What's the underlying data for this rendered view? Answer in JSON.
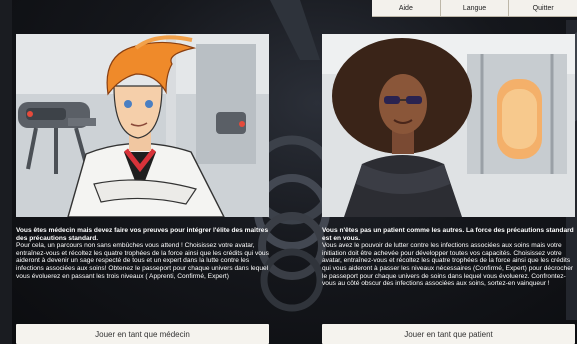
{
  "nav": {
    "items": [
      "Aide",
      "Langue",
      "Quitter"
    ]
  },
  "doctor": {
    "lead": "Vous êtes médecin mais devez faire vos preuves pour intégrer l'élite des maîtres des précautions standard.",
    "body": "Pour cela, un parcours non sans embûches vous attend ! Choisissez votre avatar, entraînez-vous et récoltez les quatre trophées de la force ainsi que les crédits qui vous aideront à devenir un sage respecté de tous et un expert dans la lutte contre les infections associées aux soins! Obtenez le passeport pour chaque univers dans lequel vous évoluerez en passant les trois niveaux ( Apprenti, Confirmé, Expert)",
    "button": "Jouer en tant que médecin"
  },
  "patient": {
    "lead": "Vous n'êtes pas un patient comme les autres. La force des précautions standard est en vous.",
    "body": "Vous avez le pouvoir de lutter contre les infections associées aux soins mais votre initiation doit être achevée pour développer toutes vos capacités. Choisissez votre avatar, entraînez-vous et récoltez les quatre trophées de la force ainsi que les crédits qui vous aideront à passer les niveaux nécessaires (Confirmé, Expert) pour décrocher le passeport pour chaque univers de soins dans lequel vous évoluerez. Confrontez-vous au côté obscur des infections associées aux soins, sortez-en vainqueur !",
    "button": "Jouer en tant que patient"
  }
}
